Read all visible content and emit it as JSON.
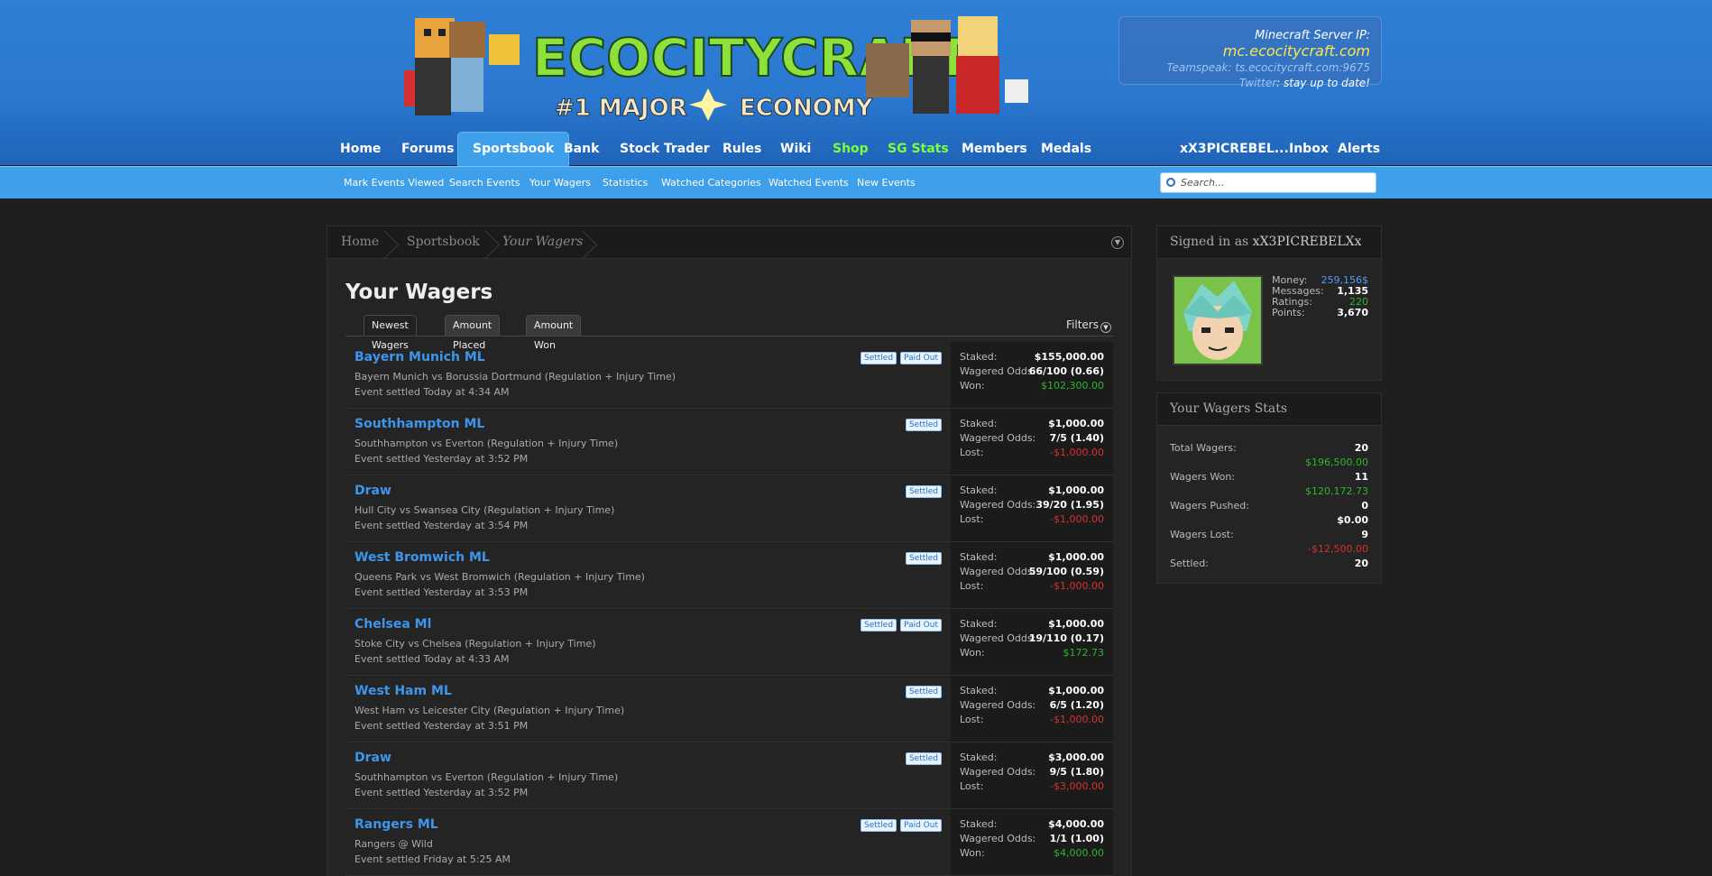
{
  "server": {
    "ip_label": "Minecraft Server IP: ",
    "ip": "mc.ecocitycraft.com",
    "teamspeak": "Teamspeak: ts.ecocitycraft.com:9675",
    "twitter_label": "Twitter",
    "twitter_text": ": stay up to date!"
  },
  "logo": {
    "text": "ECOCITYCRAFT",
    "tagline_left": "#1 MAJOR",
    "tagline_right": "ECONOMY"
  },
  "nav": {
    "home": "Home",
    "forums": "Forums",
    "sportsbook": "Sportsbook",
    "bank": "Bank",
    "stock_trader": "Stock Trader",
    "rules": "Rules",
    "wiki": "Wiki",
    "shop": "Shop",
    "sg_stats": "SG Stats",
    "members": "Members",
    "medals": "Medals",
    "username": "xX3PICREBEL...",
    "inbox": "Inbox",
    "alerts": "Alerts"
  },
  "subnav": {
    "mark_viewed": "Mark Events Viewed",
    "search_events": "Search Events",
    "your_wagers": "Your Wagers",
    "statistics": "Statistics",
    "watched_categories": "Watched Categories",
    "watched_events": "Watched Events",
    "new_events": "New Events",
    "search_placeholder": "Search..."
  },
  "breadcrumb": {
    "home": "Home",
    "sportsbook": "Sportsbook",
    "current": "Your Wagers"
  },
  "page_title": "Your Wagers",
  "tabs": {
    "newest": "Newest Wagers",
    "amount_placed": "Amount Placed",
    "amount_won": "Amount Won",
    "filters": "Filters"
  },
  "labels": {
    "staked": "Staked:",
    "odds": "Wagered Odds:",
    "won": "Won:",
    "lost": "Lost:",
    "settled": "Settled",
    "paid_out": "Paid Out"
  },
  "wagers": [
    {
      "title": "Bayern Munich ML",
      "desc": "Bayern Munich vs Borussia Dortmund (Regulation + Injury Time)",
      "date": "Event settled Today at 4:34 AM",
      "paid": true,
      "staked": "$155,000.00",
      "odds": "66/100 (0.66)",
      "result_label": "Won:",
      "result": "$102,300.00",
      "outcome": "won"
    },
    {
      "title": "Southhampton ML",
      "desc": "Southhampton vs Everton (Regulation + Injury Time)",
      "date": "Event settled Yesterday at 3:52 PM",
      "paid": false,
      "staked": "$1,000.00",
      "odds": "7/5 (1.40)",
      "result_label": "Lost:",
      "result": "-$1,000.00",
      "outcome": "lost"
    },
    {
      "title": "Draw",
      "desc": "Hull City vs Swansea City (Regulation + Injury Time)",
      "date": "Event settled Yesterday at 3:54 PM",
      "paid": false,
      "staked": "$1,000.00",
      "odds": "39/20 (1.95)",
      "result_label": "Lost:",
      "result": "-$1,000.00",
      "outcome": "lost"
    },
    {
      "title": "West Bromwich ML",
      "desc": "Queens Park vs West Bromwich (Regulation + Injury Time)",
      "date": "Event settled Yesterday at 3:53 PM",
      "paid": false,
      "staked": "$1,000.00",
      "odds": "59/100 (0.59)",
      "result_label": "Lost:",
      "result": "-$1,000.00",
      "outcome": "lost"
    },
    {
      "title": "Chelsea Ml",
      "desc": "Stoke City vs Chelsea (Regulation + Injury Time)",
      "date": "Event settled Today at 4:33 AM",
      "paid": true,
      "staked": "$1,000.00",
      "odds": "19/110 (0.17)",
      "result_label": "Won:",
      "result": "$172.73",
      "outcome": "won"
    },
    {
      "title": "West Ham ML",
      "desc": "West Ham vs Leicester City (Regulation + Injury Time)",
      "date": "Event settled Yesterday at 3:51 PM",
      "paid": false,
      "staked": "$1,000.00",
      "odds": "6/5 (1.20)",
      "result_label": "Lost:",
      "result": "-$1,000.00",
      "outcome": "lost"
    },
    {
      "title": "Draw",
      "desc": "Southhampton vs Everton (Regulation + Injury Time)",
      "date": "Event settled Yesterday at 3:52 PM",
      "paid": false,
      "staked": "$3,000.00",
      "odds": "9/5 (1.80)",
      "result_label": "Lost:",
      "result": "-$3,000.00",
      "outcome": "lost"
    },
    {
      "title": "Rangers ML",
      "desc": "Rangers @ Wild",
      "date": "Event settled Friday at 5:25 AM",
      "paid": true,
      "staked": "$4,000.00",
      "odds": "1/1 (1.00)",
      "result_label": "Won:",
      "result": "$4,000.00",
      "outcome": "won"
    }
  ],
  "user_box": {
    "signed_in_label": "Signed in as ",
    "username": "xX3PICREBELXx",
    "money_label": "Money:",
    "money": "259,156$",
    "messages_label": "Messages:",
    "messages": "1,135",
    "ratings_label": "Ratings:",
    "ratings": "220",
    "points_label": "Points:",
    "points": "3,670"
  },
  "stats_box": {
    "title": "Your Wagers Stats",
    "total_label": "Total Wagers:",
    "total": "20",
    "total_amount": "$196,500.00",
    "won_label": "Wagers Won:",
    "won": "11",
    "won_amount": "$120,172.73",
    "pushed_label": "Wagers Pushed:",
    "pushed": "0",
    "pushed_amount": "$0.00",
    "lost_label": "Wagers Lost:",
    "lost": "9",
    "lost_amount": "-$12,500.00",
    "settled_label": "Settled:",
    "settled": "20"
  },
  "colors": {
    "header_blue": "#2a77cf",
    "subnav_blue": "#3ea0ea",
    "link_blue": "#3d96ea",
    "won_green": "#2cb52c",
    "lost_red": "#d83030",
    "shop_green": "#7dff3c"
  }
}
